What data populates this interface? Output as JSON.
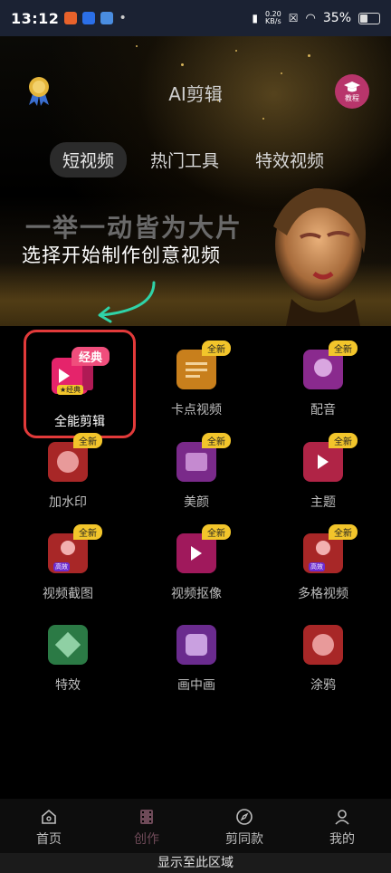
{
  "status": {
    "time": "13:12",
    "speed_top": "0.20",
    "speed_bottom": "KB/s",
    "battery": "35%"
  },
  "header": {
    "title": "AI剪辑",
    "tutorial_label": "教程"
  },
  "tabs": [
    {
      "label": "短视频",
      "active": true
    },
    {
      "label": "热门工具",
      "active": false
    },
    {
      "label": "特效视频",
      "active": false
    }
  ],
  "banner": {
    "slogan": "一举一动皆为大片",
    "subtitle": "选择开始制作创意视频"
  },
  "featured": {
    "badge": "经典",
    "small_badge": "★经典",
    "label": "全能剪辑"
  },
  "tools": [
    {
      "label": "卡点视频",
      "badge": "全新",
      "color": "#c87f1c"
    },
    {
      "label": "配音",
      "badge": "全新",
      "color": "#8a2a8e"
    },
    {
      "label": "加水印",
      "badge": "全新",
      "color": "#a82727"
    },
    {
      "label": "美颜",
      "badge": "全新",
      "color": "#7a2a8a"
    },
    {
      "label": "主题",
      "badge": "全新",
      "color": "#b02446"
    },
    {
      "label": "视频截图",
      "badge": "全新",
      "color": "#a82727"
    },
    {
      "label": "视频抠像",
      "badge": "全新",
      "color": "#a0195c"
    },
    {
      "label": "多格视频",
      "badge": "全新",
      "color": "#a82727"
    },
    {
      "label": "特效",
      "badge": "",
      "color": "#2b7a45"
    },
    {
      "label": "画中画",
      "badge": "",
      "color": "#6a2b8e"
    },
    {
      "label": "涂鸦",
      "badge": "",
      "color": "#a82727"
    }
  ],
  "small_badge_hd": "高效",
  "nav": [
    {
      "label": "首页",
      "icon": "home-icon",
      "active": false
    },
    {
      "label": "创作",
      "icon": "film-icon",
      "active": true
    },
    {
      "label": "剪同款",
      "icon": "compass-icon",
      "active": false
    },
    {
      "label": "我的",
      "icon": "user-icon",
      "active": false
    }
  ],
  "gesture": "显示至此区域"
}
